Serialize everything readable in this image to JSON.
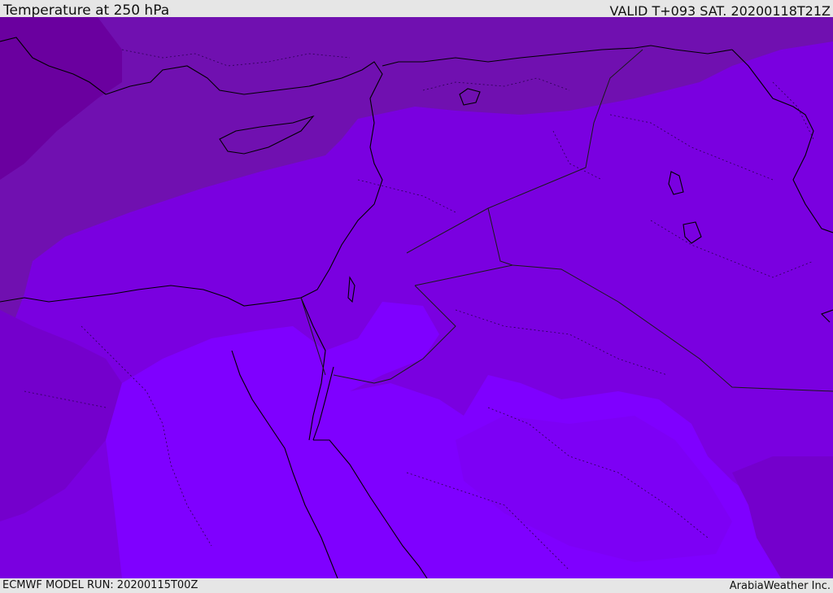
{
  "header": {
    "title": "Temperature at 250 hPa",
    "valid_time": "VALID T+093 SAT. 20200118T21Z"
  },
  "footer": {
    "model_run": "ECMWF MODEL RUN: 20200115T00Z",
    "credit": "ArabiaWeather Inc."
  },
  "map": {
    "variable": "Temperature",
    "level_hpa": 250,
    "region": "Eastern Mediterranean and Middle East",
    "shading_colors": {
      "darkest": "#6a009f",
      "dark": "#7010b0",
      "mid": "#7400cc",
      "base": "#7a00e0",
      "light": "#7d00f5",
      "lightest": "#7f00ff"
    },
    "line_colors": {
      "coastline": "#000000",
      "border": "#1a1a1a"
    }
  }
}
